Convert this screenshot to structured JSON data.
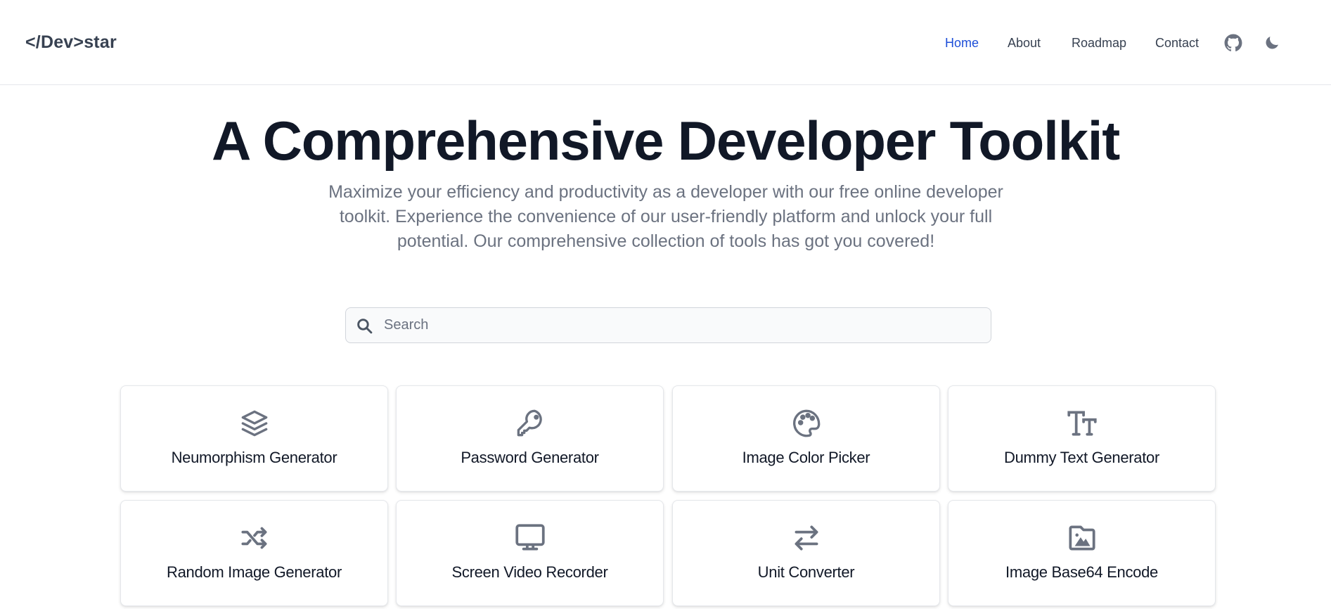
{
  "header": {
    "logo": "</Dev>star",
    "nav": [
      {
        "label": "Home",
        "active": true
      },
      {
        "label": "About",
        "active": false
      },
      {
        "label": "Roadmap",
        "active": false
      },
      {
        "label": "Contact",
        "active": false
      }
    ],
    "icons": {
      "github": "github-icon",
      "theme": "moon-icon"
    }
  },
  "hero": {
    "title": "A Comprehensive Developer Toolkit",
    "subtitle": "Maximize your efficiency and productivity as a developer with our free online developer toolkit. Experience the convenience of our user-friendly platform and unlock your full potential. Our comprehensive collection of tools has got you covered!"
  },
  "search": {
    "placeholder": "Search",
    "value": "",
    "icon": "search-icon"
  },
  "tools": [
    {
      "label": "Neumorphism Generator",
      "icon": "layers-icon"
    },
    {
      "label": "Password Generator",
      "icon": "key-icon"
    },
    {
      "label": "Image Color Picker",
      "icon": "palette-icon"
    },
    {
      "label": "Dummy Text Generator",
      "icon": "text-size-icon"
    },
    {
      "label": "Random Image Generator",
      "icon": "shuffle-icon"
    },
    {
      "label": "Screen Video Recorder",
      "icon": "monitor-icon"
    },
    {
      "label": "Unit Converter",
      "icon": "arrows-exchange-icon"
    },
    {
      "label": "Image Base64 Encode",
      "icon": "image-file-icon"
    }
  ],
  "colors": {
    "accent": "#1d4ed8",
    "text": "#111827",
    "muted": "#6b7280",
    "nav_text": "#374151",
    "border": "#e5e7eb"
  }
}
